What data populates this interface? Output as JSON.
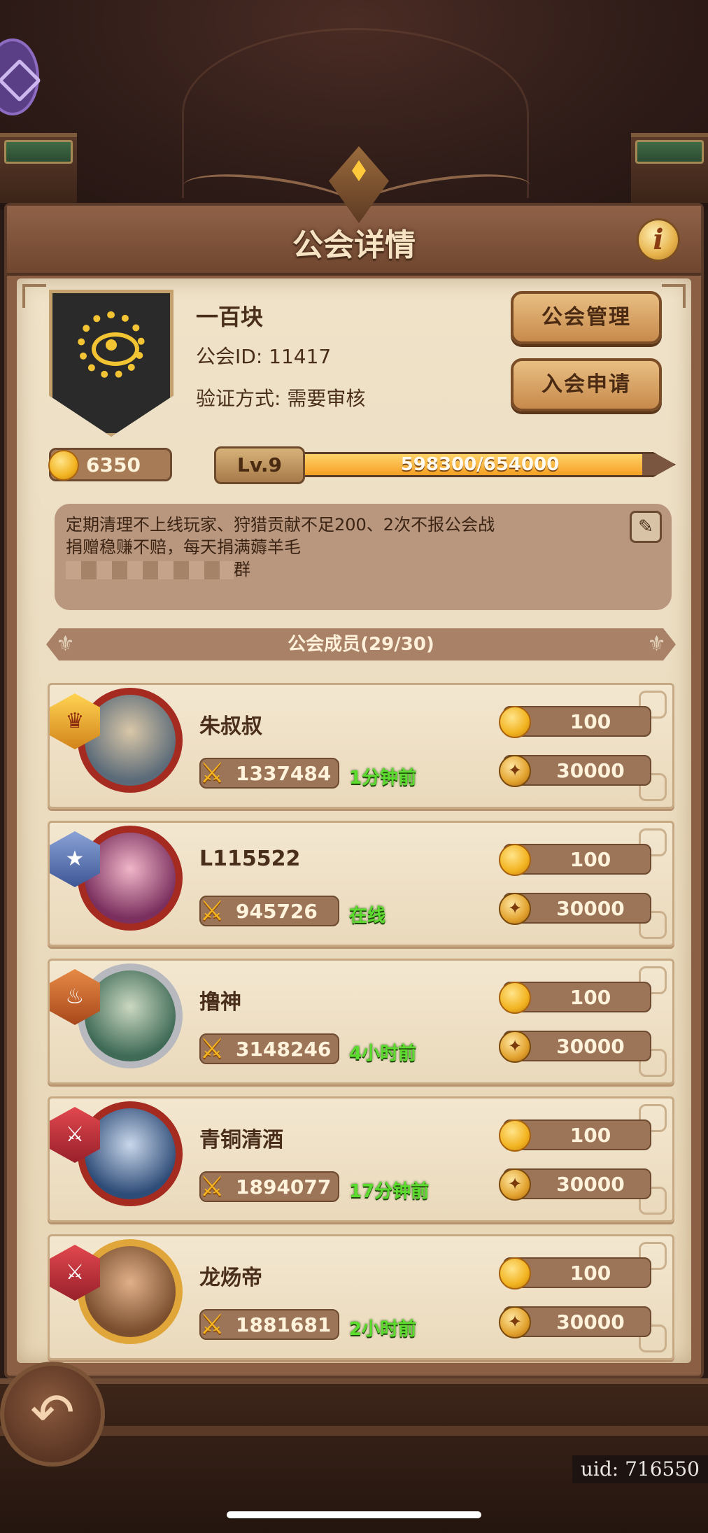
{
  "header": {
    "title": "公会详情",
    "info_label": "i"
  },
  "guild": {
    "name": "一百块",
    "id_text": "公会ID: 11417",
    "verify_text": "验证方式: 需要审核",
    "coins": "6350",
    "level": "Lv.9",
    "exp_text": "598300/654000",
    "exp_progress": 0.915,
    "notice_lines": [
      "定期清理不上线玩家、狩猎贡献不足200、2次不报公会战",
      "捐赠稳赚不赔，每天捐满薅羊毛",
      "群"
    ]
  },
  "buttons": {
    "manage": "公会管理",
    "apply": "入会申请"
  },
  "members_section": {
    "title": "公会成员(29/30)"
  },
  "members": [
    {
      "name": "朱叔叔",
      "power": "1337484",
      "status": "1分钟前",
      "contrib": "100",
      "donate": "30000",
      "rank_icon": "crown-rank-icon",
      "rank_glyph": "♛",
      "avatar_style": "red",
      "avatar_glyph": "☺"
    },
    {
      "name": "L115522",
      "power": "945726",
      "status": "在线",
      "contrib": "100",
      "donate": "30000",
      "rank_icon": "star-rank-icon",
      "rank_glyph": "★",
      "avatar_style": "pink",
      "avatar_glyph": "☺"
    },
    {
      "name": "撸神",
      "power": "3148246",
      "status": "4小时前",
      "contrib": "100",
      "donate": "30000",
      "rank_icon": "flame-rank-icon",
      "rank_glyph": "♨",
      "avatar_style": "silver",
      "avatar_glyph": "☺"
    },
    {
      "name": "青铜清酒",
      "power": "1894077",
      "status": "17分钟前",
      "contrib": "100",
      "donate": "30000",
      "rank_icon": "swords-rank-icon",
      "rank_glyph": "⚔",
      "avatar_style": "blue",
      "avatar_glyph": "☺"
    },
    {
      "name": "龙炀帝",
      "power": "1881681",
      "status": "2小时前",
      "contrib": "100",
      "donate": "30000",
      "rank_icon": "swords-rank-icon",
      "rank_glyph": "⚔",
      "avatar_style": "gold",
      "avatar_glyph": "☺"
    }
  ],
  "footer": {
    "back_glyph": "↶",
    "uid": "uid: 716550"
  },
  "icons": {
    "coin": "coin-icon",
    "power": "crossed-swords-icon",
    "donate": "gold-medal-icon",
    "edit": "quill-edit-icon"
  },
  "colors": {
    "online_green": "#5bdc2e",
    "parchment": "#efe2c8",
    "frame_brown": "#8a5f44"
  }
}
